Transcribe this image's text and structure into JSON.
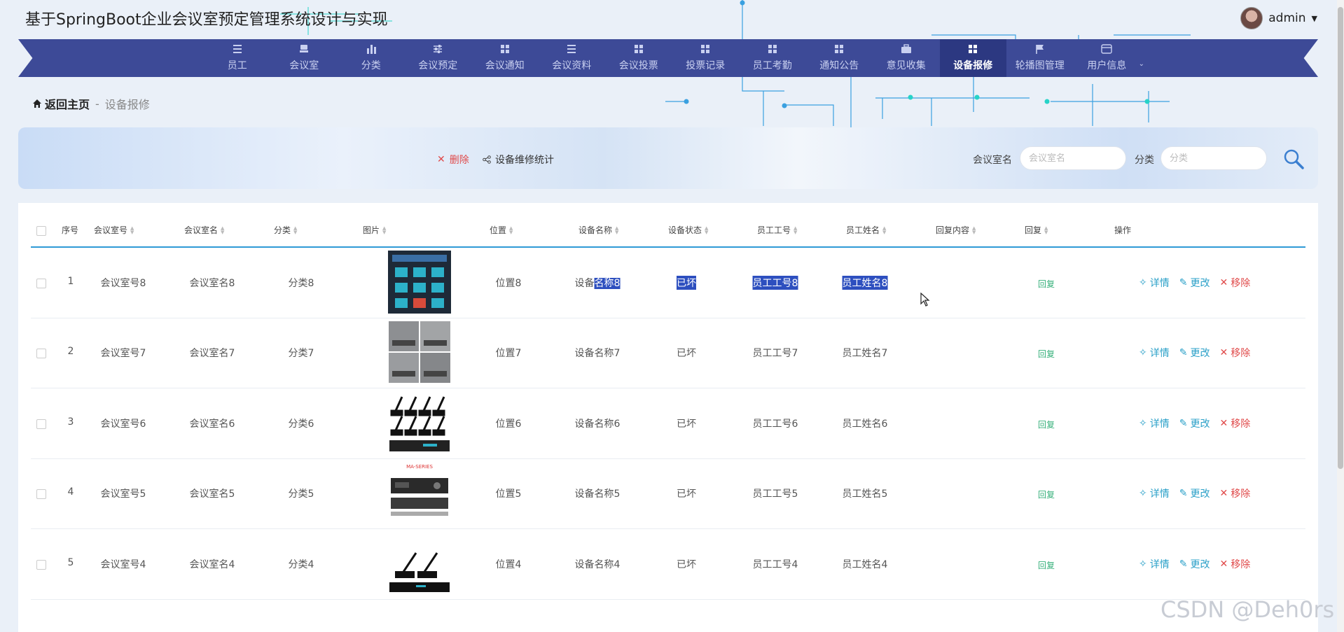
{
  "app": {
    "title": "基于SpringBoot企业会议室预定管理系统设计与实现",
    "user_name": "admin"
  },
  "nav": {
    "items": [
      {
        "label": "员工",
        "icon": "list-icon"
      },
      {
        "label": "会议室",
        "icon": "chair-icon"
      },
      {
        "label": "分类",
        "icon": "bar-chart-icon"
      },
      {
        "label": "会议预定",
        "icon": "sliders-icon"
      },
      {
        "label": "会议通知",
        "icon": "grid-icon"
      },
      {
        "label": "会议资料",
        "icon": "list-icon"
      },
      {
        "label": "会议投票",
        "icon": "grid-icon"
      },
      {
        "label": "投票记录",
        "icon": "grid-icon"
      },
      {
        "label": "员工考勤",
        "icon": "grid-icon"
      },
      {
        "label": "通知公告",
        "icon": "grid-icon"
      },
      {
        "label": "意见收集",
        "icon": "briefcase-icon"
      },
      {
        "label": "设备报修",
        "icon": "grid-icon"
      },
      {
        "label": "轮播图管理",
        "icon": "flag-icon"
      },
      {
        "label": "用户信息",
        "icon": "card-icon"
      }
    ],
    "active": "设备报修"
  },
  "breadcrumb": {
    "home": "返回主页",
    "separator": "-",
    "current": "设备报修"
  },
  "toolbar": {
    "delete_label": "删除",
    "stats_label": "设备维修统计"
  },
  "search": {
    "room_label": "会议室名",
    "room_placeholder": "会议室名",
    "category_label": "分类",
    "category_placeholder": "分类"
  },
  "table": {
    "headers": {
      "index": "序号",
      "room_no": "会议室号",
      "room_name": "会议室名",
      "category": "分类",
      "image": "图片",
      "location": "位置",
      "device_name": "设备名称",
      "device_status": "设备状态",
      "emp_no": "员工工号",
      "emp_name": "员工姓名",
      "reply_content": "回复内容",
      "reply": "回复",
      "ops": "操作"
    },
    "rows": [
      {
        "index": "1",
        "room_no": "会议室号8",
        "room_name": "会议室名8",
        "category": "分类8",
        "location": "位置8",
        "device_name": "设备名称8",
        "status": "已坏",
        "emp_no": "员工工号8",
        "emp_name": "员工姓名8",
        "reply_content": "",
        "image": "control-panel"
      },
      {
        "index": "2",
        "room_no": "会议室号7",
        "room_name": "会议室名7",
        "category": "分类7",
        "location": "位置7",
        "device_name": "设备名称7",
        "status": "已坏",
        "emp_no": "员工工号7",
        "emp_name": "员工姓名7",
        "reply_content": "",
        "image": "meeting-rooms"
      },
      {
        "index": "3",
        "room_no": "会议室号6",
        "room_name": "会议室名6",
        "category": "分类6",
        "location": "位置6",
        "device_name": "设备名称6",
        "status": "已坏",
        "emp_no": "员工工号6",
        "emp_name": "员工姓名6",
        "reply_content": "",
        "image": "microphones"
      },
      {
        "index": "4",
        "room_no": "会议室号5",
        "room_name": "会议室名5",
        "category": "分类5",
        "location": "位置5",
        "device_name": "设备名称5",
        "status": "已坏",
        "emp_no": "员工工号5",
        "emp_name": "员工姓名5",
        "reply_content": "",
        "image": "amplifier",
        "image_text": "MA-SERIES"
      },
      {
        "index": "5",
        "room_no": "会议室号4",
        "room_name": "会议室名4",
        "category": "分类4",
        "location": "位置4",
        "device_name": "设备名称4",
        "status": "已坏",
        "emp_no": "员工工号4",
        "emp_name": "员工姓名4",
        "reply_content": "",
        "image": "mic-pair"
      }
    ],
    "actions": {
      "reply": "回复",
      "detail": "详情",
      "edit": "更改",
      "remove": "移除"
    }
  },
  "watermark": "CSDN @Deh0rs",
  "colors": {
    "nav_bg": "#3d4a97",
    "nav_active": "#2c3881",
    "accent": "#2f9ad6",
    "danger": "#e04a4a",
    "reply_green": "#36b07a"
  }
}
